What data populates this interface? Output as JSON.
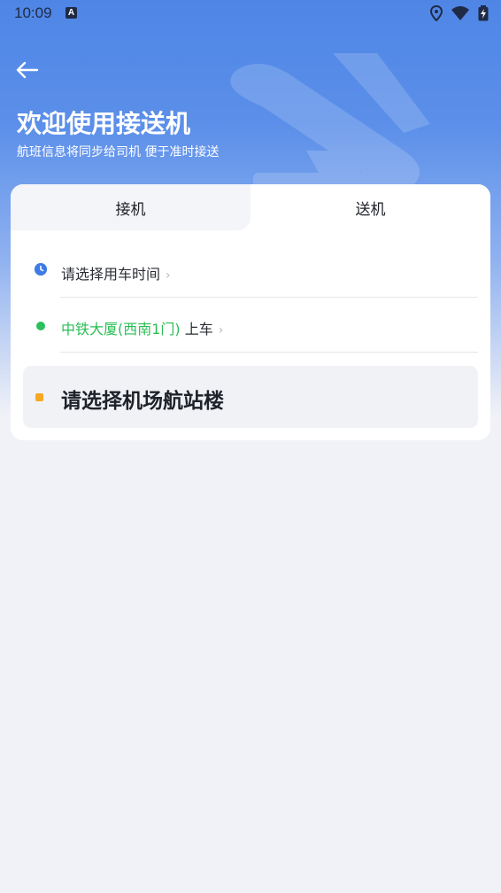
{
  "status_bar": {
    "time": "10:09",
    "notification_letter": "A"
  },
  "header": {
    "title": "欢迎使用接送机",
    "subtitle": "航班信息将同步给司机 便于准时接送"
  },
  "tabs": [
    {
      "label": "接机",
      "selected": false
    },
    {
      "label": "送机",
      "selected": true
    }
  ],
  "form": {
    "time_placeholder": "请选择用车时间",
    "pickup_location": "中铁大厦(西南1门)",
    "pickup_suffix": "上车",
    "airport_placeholder": "请选择机场航站楼"
  },
  "colors": {
    "header_gradient_top": "#4f86e6",
    "accent_blue": "#3e7be6",
    "location_green": "#2bbd55",
    "airport_orange": "#f7a823",
    "background": "#f1f2f7"
  },
  "icons": [
    "back-arrow-icon",
    "clock-icon",
    "location-dot-icon",
    "airport-square-icon",
    "location-pin-icon",
    "wifi-icon",
    "battery-icon",
    "plane-watermark-icon"
  ]
}
